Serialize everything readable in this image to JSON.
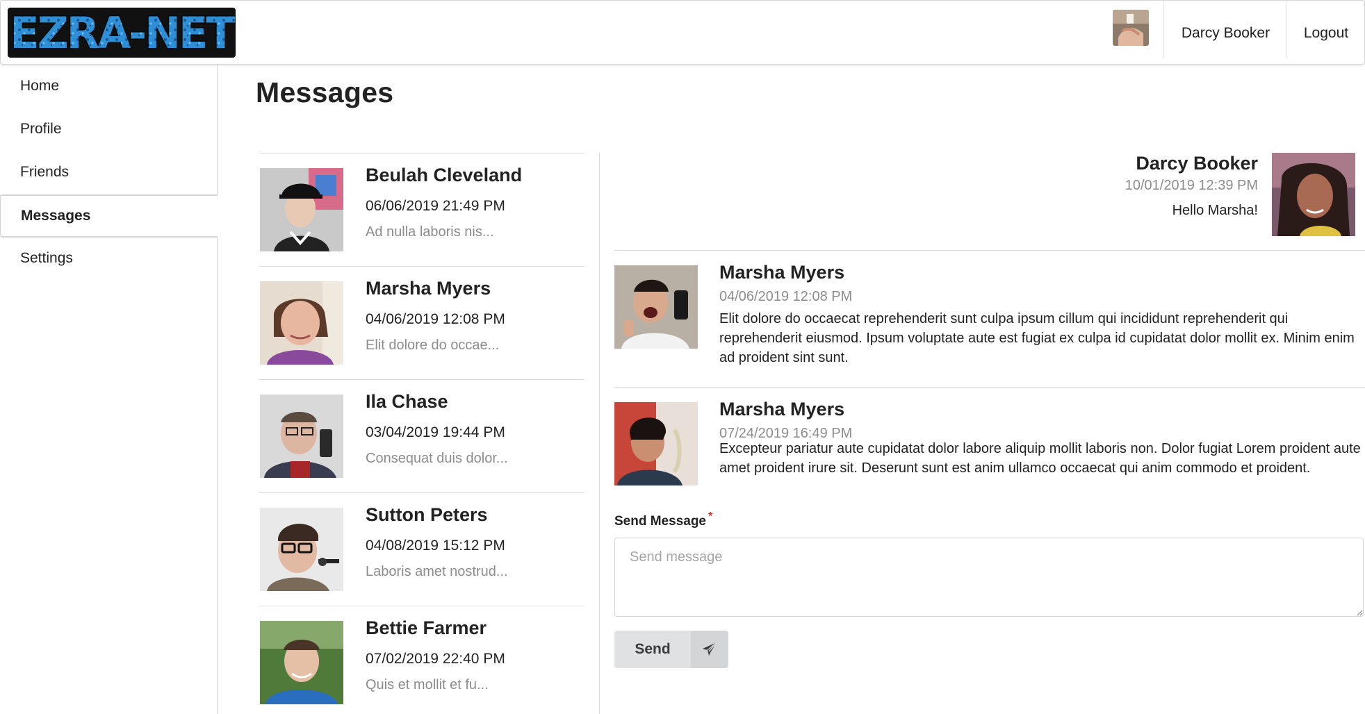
{
  "header": {
    "logo_text": "EZRA-NET",
    "user_name": "Darcy Booker",
    "logout_label": "Logout"
  },
  "sidebar": {
    "items": [
      {
        "label": "Home"
      },
      {
        "label": "Profile"
      },
      {
        "label": "Friends"
      },
      {
        "label": "Messages",
        "active": true
      },
      {
        "label": "Settings"
      }
    ]
  },
  "page_title": "Messages",
  "conversations": [
    {
      "name": "Beulah Cleveland",
      "date": "06/06/2019 21:49 PM",
      "preview": "Ad nulla laboris nis..."
    },
    {
      "name": "Marsha Myers",
      "date": "04/06/2019 12:08 PM",
      "preview": "Elit dolore do occae..."
    },
    {
      "name": "Ila Chase",
      "date": "03/04/2019 19:44 PM",
      "preview": "Consequat duis dolor..."
    },
    {
      "name": "Sutton Peters",
      "date": "04/08/2019 15:12 PM",
      "preview": "Laboris amet nostrud..."
    },
    {
      "name": "Bettie Farmer",
      "date": "07/02/2019 22:40 PM",
      "preview": "Quis et mollit et fu..."
    }
  ],
  "thread": {
    "own_message": {
      "name": "Darcy Booker",
      "date": "10/01/2019 12:39 PM",
      "text": "Hello Marsha!"
    },
    "messages": [
      {
        "name": "Marsha Myers",
        "date": "04/06/2019 12:08 PM",
        "text": "Elit dolore do occaecat reprehenderit sunt culpa ipsum cillum qui incididunt reprehenderit qui reprehenderit eiusmod. Ipsum voluptate aute est fugiat ex culpa id cupidatat dolor mollit ex. Minim enim ad proident sint sunt."
      },
      {
        "name": "Marsha Myers",
        "date": "07/24/2019 16:49 PM",
        "text": "Excepteur pariatur aute cupidatat dolor labore aliquip mollit laboris non. Dolor fugiat Lorem proident aute amet proident irure sit. Deserunt sunt est anim ullamco occaecat qui anim commodo et proident."
      }
    ]
  },
  "compose": {
    "label": "Send Message",
    "required_mark": "*",
    "placeholder": "Send message",
    "value": "",
    "send_label": "Send",
    "send_icon": "paper-plane-icon"
  },
  "colors": {
    "border": "#d4d4d5",
    "muted_text": "#8c8c8c",
    "button_bg": "#e0e1e2",
    "logo_blue": "#2f8fd6",
    "required": "#db2828"
  }
}
